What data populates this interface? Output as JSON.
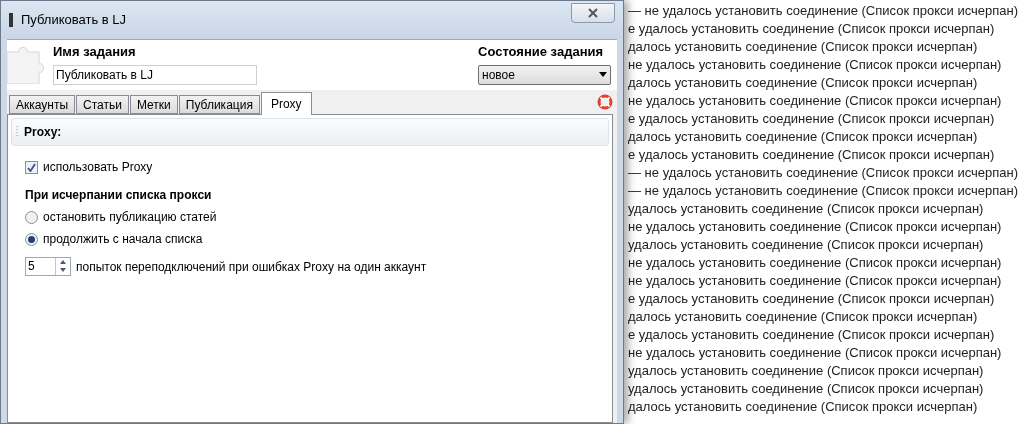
{
  "dialog": {
    "title": "Публиковать в LJ"
  },
  "task_name": {
    "label": "Имя задания",
    "value": "Публиковать в LJ"
  },
  "task_state": {
    "label": "Состояние задания",
    "value": "новое"
  },
  "tabs": [
    {
      "label": "Аккаунты",
      "selected": false
    },
    {
      "label": "Статьи",
      "selected": false
    },
    {
      "label": "Метки",
      "selected": false
    },
    {
      "label": "Публикация",
      "selected": false
    },
    {
      "label": "Proxy",
      "selected": true
    }
  ],
  "section": {
    "title": "Proxy:"
  },
  "use_proxy": {
    "label": "использовать Proxy",
    "checked": true
  },
  "exhaust_group": {
    "title": "При исчерпании списка прокси",
    "options": [
      {
        "label": "остановить публикацию статей",
        "selected": false
      },
      {
        "label": "продолжить с начала списка",
        "selected": true
      }
    ]
  },
  "retries": {
    "value": "5",
    "label": "попыток переподключений при ошибках Proxy на один аккаунт"
  },
  "log_lines": [
    "— не удалось установить соединение (Список прокси исчерпан)",
    "е удалось установить соединение (Список прокси исчерпан)",
    "далось установить соединение (Список прокси исчерпан)",
    "не удалось установить соединение (Список прокси исчерпан)",
    "далось установить соединение (Список прокси исчерпан)",
    "не удалось установить соединение (Список прокси исчерпан)",
    "е удалось установить соединение (Список прокси исчерпан)",
    "далось установить соединение (Список прокси исчерпан)",
    "е удалось установить соединение (Список прокси исчерпан)",
    "— не удалось установить соединение (Список прокси исчерпан)",
    "— не удалось установить соединение (Список прокси исчерпан)",
    "удалось установить соединение (Список прокси исчерпан)",
    "не удалось установить соединение (Список прокси исчерпан)",
    "удалось установить соединение (Список прокси исчерпан)",
    "не удалось установить соединение (Список прокси исчерпан)",
    "не удалось установить соединение (Список прокси исчерпан)",
    "е удалось установить соединение (Список прокси исчерпан)",
    "далось установить соединение (Список прокси исчерпан)",
    "е удалось установить соединение (Список прокси исчерпан)",
    "не удалось установить соединение (Список прокси исчерпан)",
    "удалось установить соединение (Список прокси исчерпан)",
    "удалось установить соединение (Список прокси исчерпан)",
    "далось установить соединение (Список прокси исчерпан)"
  ]
}
